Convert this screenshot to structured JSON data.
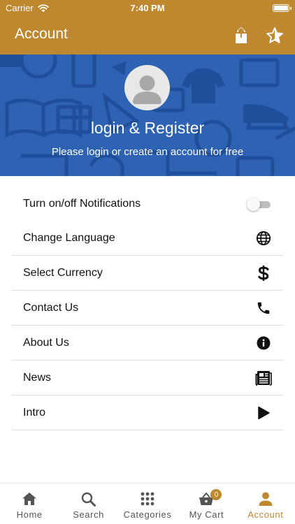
{
  "status_bar": {
    "carrier": "Carrier",
    "time": "7:40 PM"
  },
  "app_bar": {
    "title": "Account",
    "share_icon": "share-icon",
    "star_icon": "star-icon"
  },
  "profile": {
    "title": "login & Register",
    "subtitle": "Please login or create an account for free"
  },
  "menu": {
    "notifications": {
      "label": "Turn on/off Notifications",
      "enabled": false
    },
    "items": [
      {
        "label": "Change Language",
        "icon": "globe-icon"
      },
      {
        "label": "Select Currency",
        "icon": "dollar-icon"
      },
      {
        "label": "Contact Us",
        "icon": "phone-icon"
      },
      {
        "label": "About Us",
        "icon": "info-icon"
      },
      {
        "label": "News",
        "icon": "newspaper-icon"
      },
      {
        "label": "Intro",
        "icon": "play-icon"
      }
    ]
  },
  "tabs": [
    {
      "label": "Home",
      "icon": "home-icon",
      "active": false
    },
    {
      "label": "Search",
      "icon": "search-icon",
      "active": false
    },
    {
      "label": "Categories",
      "icon": "grid-icon",
      "active": false
    },
    {
      "label": "My Cart",
      "icon": "cart-icon",
      "active": false,
      "badge": "0"
    },
    {
      "label": "Account",
      "icon": "person-icon",
      "active": true
    }
  ],
  "colors": {
    "brand": "#c0882e",
    "banner": "#2e62b3",
    "banner_pattern": "#1f4f9b"
  }
}
